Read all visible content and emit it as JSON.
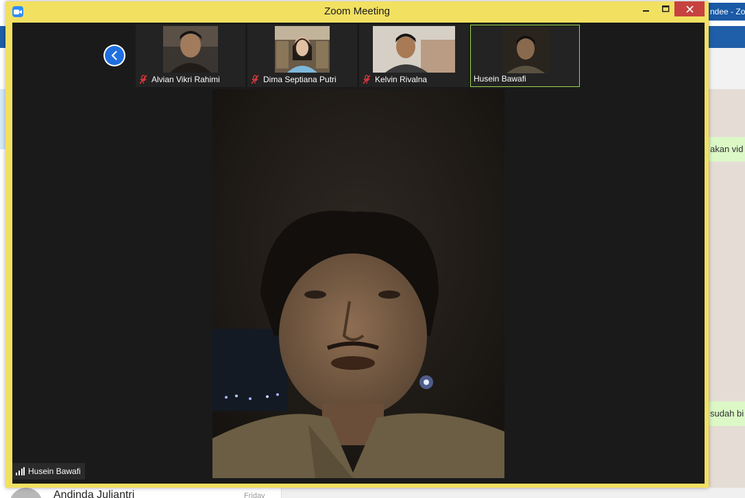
{
  "window": {
    "title": "Zoom Meeting",
    "accent": "#f2e061"
  },
  "background": {
    "right_title_fragment": "ndee - Zo",
    "chat_snippets": [
      "akan vid",
      "sudah bi"
    ],
    "contact_name": "Andinda Juliantri",
    "contact_date": "Friday"
  },
  "thumbnails": [
    {
      "name": "Alvian Vikri Rahimi",
      "muted": true
    },
    {
      "name": "Dima Septiana Putri",
      "muted": true
    },
    {
      "name": "Kelvin Rivalna",
      "muted": true
    },
    {
      "name": "Husein Bawafi",
      "muted": false,
      "active": true
    }
  ],
  "active_speaker": {
    "name": "Husein Bawafi"
  },
  "icons": {
    "prev": "chevron-left-icon",
    "mute": "mic-muted-icon",
    "signal": "signal-bars-icon",
    "app": "zoom-app-icon"
  }
}
